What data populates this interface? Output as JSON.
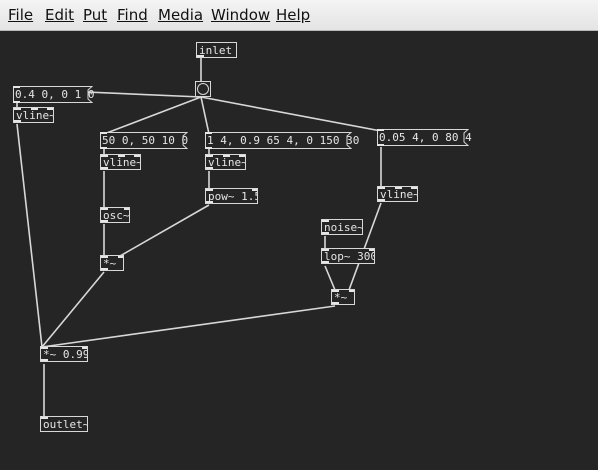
{
  "menu": [
    "File",
    "Edit",
    "Put",
    "Find",
    "Media",
    "Window",
    "Help"
  ],
  "menu_mnemonic_index": [
    0,
    0,
    0,
    0,
    0,
    0,
    0
  ],
  "objects": {
    "inlet": "inlet",
    "vline_main": "vline~",
    "vline_a": "vline~",
    "osc": "osc~",
    "mul_a": "*~",
    "vline_b": "vline~",
    "pow": "pow~ 1.5",
    "vline_c": "vline~",
    "noise": "noise~",
    "lop": "lop~ 300",
    "mul_b": "*~",
    "mul_out": "*~ 0.99",
    "outlet": "outlet~"
  },
  "messages": {
    "env_main": "0.4 0, 0 1 0",
    "env_a": "50 0, 50 10 0",
    "env_b": "1 4, 0.9 65 4, 0 150 30",
    "env_c": "0.05 4, 0 80 4"
  },
  "colors": {
    "canvas_bg": "#252525",
    "wire": "#d8d8d8",
    "menubar": "#ececec"
  }
}
